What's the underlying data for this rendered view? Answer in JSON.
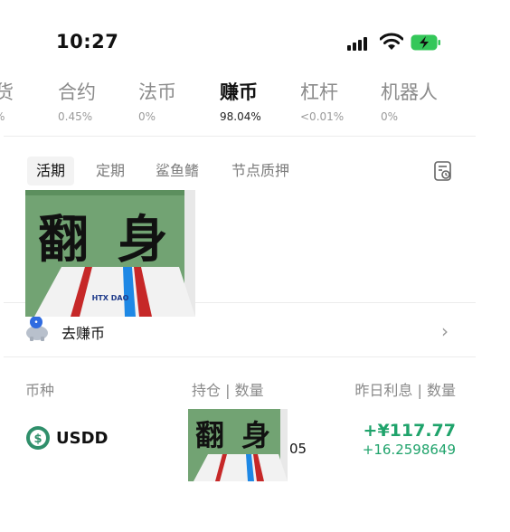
{
  "status_bar": {
    "time": "10:27"
  },
  "market_tabs": [
    {
      "label": "货",
      "percent": "%"
    },
    {
      "label": "合约",
      "percent": "0.45%"
    },
    {
      "label": "法币",
      "percent": "0%"
    },
    {
      "label": "赚币",
      "percent": "98.04%",
      "active": true
    },
    {
      "label": "杠杆",
      "percent": "<0.01%"
    },
    {
      "label": "机器人",
      "percent": "0%"
    }
  ],
  "sub_tabs": [
    {
      "label": "活期",
      "active": true
    },
    {
      "label": "定期"
    },
    {
      "label": "鲨鱼鳍"
    },
    {
      "label": "节点质押"
    }
  ],
  "banner": {
    "text": "翻 身",
    "logo": "HTX DAO"
  },
  "earn_link": {
    "label": "去赚币"
  },
  "table": {
    "headers": {
      "currency": "币种",
      "holding": "持仓 | 数量",
      "interest": "昨日利息 | 数量"
    },
    "rows": [
      {
        "coin": "USDD",
        "holding_tail": "05",
        "interest_cny": "+¥117.77",
        "interest_qty": "+16.2598649"
      }
    ]
  },
  "colors": {
    "accent_green": "#1fa36b",
    "battery_green": "#34c759"
  },
  "icons": [
    "signal-icon",
    "wifi-icon",
    "battery-charging-icon",
    "history-icon",
    "piggy-bank-icon",
    "chevron-right-icon",
    "usdd-coin-icon"
  ]
}
